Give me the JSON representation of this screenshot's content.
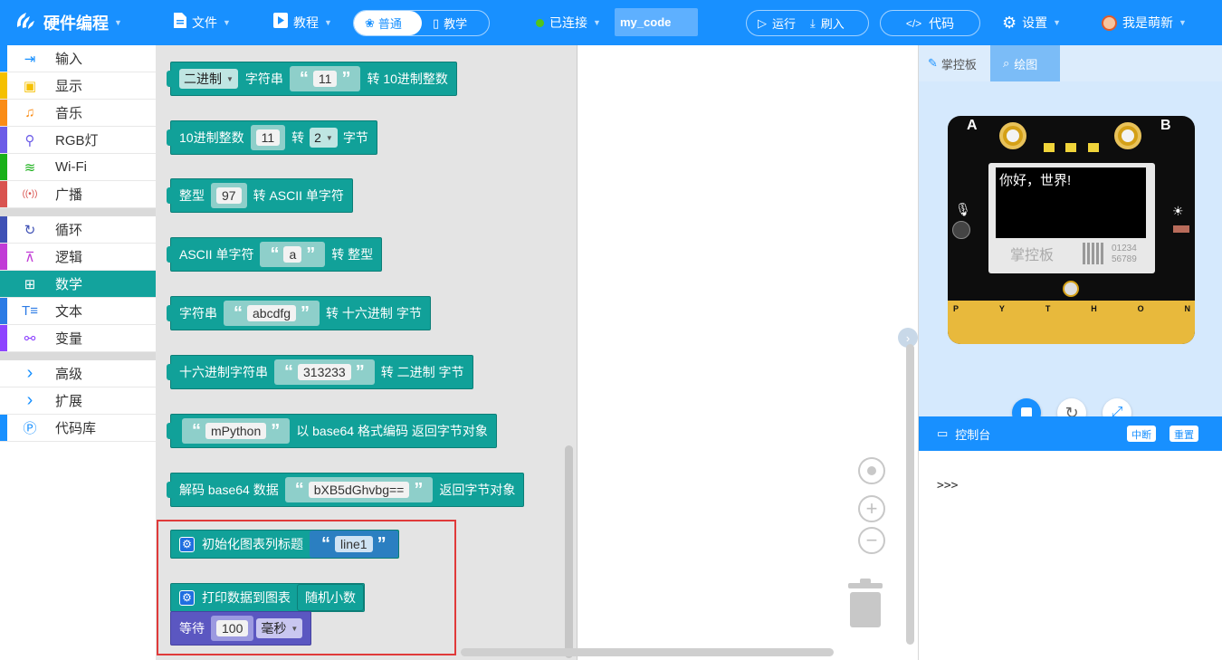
{
  "header": {
    "app_title": "硬件编程",
    "file_label": "文件",
    "tutorial_label": "教程",
    "mode_normal": "普通",
    "mode_teach": "教学",
    "status": "已连接",
    "project_name": "my_code",
    "run_label": "运行",
    "flash_label": "刷入",
    "code_label": "代码",
    "settings_label": "设置",
    "user_label": "我是萌新"
  },
  "sidebar": {
    "group1": [
      {
        "label": "输入",
        "color": "#1890ff",
        "icon": "input-icon"
      },
      {
        "label": "显示",
        "color": "#f5c000",
        "icon": "display-icon"
      },
      {
        "label": "音乐",
        "color": "#fa8c16",
        "icon": "music-icon"
      },
      {
        "label": "RGB灯",
        "color": "#6c5ce7",
        "icon": "bulb-icon"
      },
      {
        "label": "Wi-Fi",
        "color": "#19b019",
        "icon": "wifi-icon"
      },
      {
        "label": "广播",
        "color": "#d9534f",
        "icon": "broadcast-icon"
      }
    ],
    "group2": [
      {
        "label": "循环",
        "color": "#3f51b5",
        "icon": "loop-icon"
      },
      {
        "label": "逻辑",
        "color": "#c13cd6",
        "icon": "logic-icon"
      },
      {
        "label": "数学",
        "color": "#13a39d",
        "icon": "math-icon"
      },
      {
        "label": "文本",
        "color": "#2c7be5",
        "icon": "text-icon"
      },
      {
        "label": "变量",
        "color": "#8e44ff",
        "icon": "variable-icon"
      }
    ],
    "group3": [
      {
        "label": "高级",
        "color": "#ffffff",
        "icon": "chevron-right-icon"
      },
      {
        "label": "扩展",
        "color": "#ffffff",
        "icon": "chevron-right-icon"
      },
      {
        "label": "代码库",
        "color": "#1890ff",
        "icon": "library-icon"
      }
    ]
  },
  "blocks": {
    "b1": {
      "dropdown": "二进制",
      "text1": "字符串",
      "value": "11",
      "text2": "转 10进制整数"
    },
    "b2": {
      "text1": "10进制整数",
      "value": "11",
      "text2": "转",
      "dropdown": "2",
      "text3": "字节"
    },
    "b3": {
      "text1": "整型",
      "value": "97",
      "text2": "转 ASCII 单字符"
    },
    "b4": {
      "text1": "ASCII 单字符",
      "value": "a",
      "text2": "转 整型"
    },
    "b5": {
      "text1": "字符串",
      "value": "abcdfg",
      "text2": "转 十六进制 字节"
    },
    "b6": {
      "text1": "十六进制字符串",
      "value": "313233",
      "text2": "转 二进制 字节"
    },
    "b7": {
      "value": "mPython",
      "text2": "以 base64 格式编码 返回字节对象"
    },
    "b8": {
      "text1": "解码 base64 数据",
      "value": "bXB5dGhvbg==",
      "text2": "返回字节对象"
    },
    "b9": {
      "text1": "初始化图表列标题",
      "value": "line1"
    },
    "b10": {
      "text1": "打印数据到图表",
      "text2": "随机小数"
    },
    "b11": {
      "text1": "等待",
      "value": "100",
      "dropdown": "毫秒"
    }
  },
  "panel": {
    "tab_board": "掌控板",
    "tab_draw": "绘图",
    "screen_text": "你好，世界!",
    "board_logo": "掌控板",
    "board_num1": "01234",
    "board_num2": "56789",
    "label_a": "A",
    "label_b": "B",
    "python_letters": [
      "P",
      "Y",
      "T",
      "H",
      "O",
      "N"
    ],
    "console_title": "控制台",
    "interrupt": "中断",
    "reset": "重置",
    "prompt": ">>>"
  }
}
